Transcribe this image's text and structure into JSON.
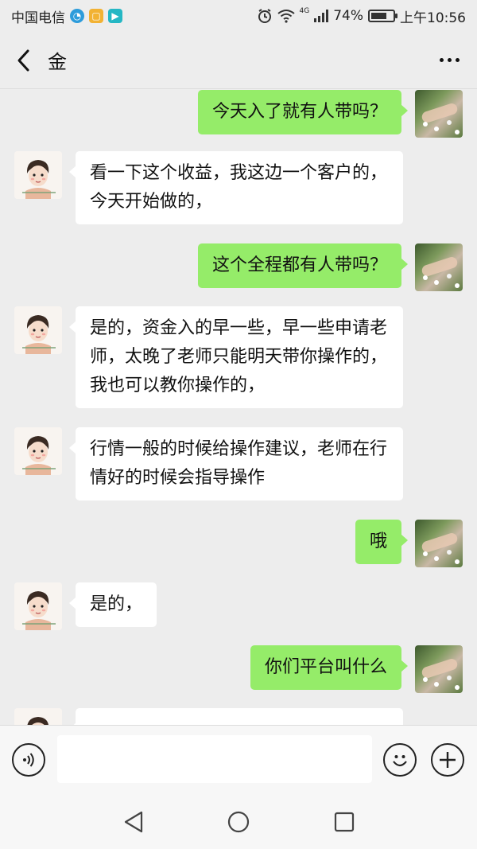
{
  "status": {
    "carrier": "中国电信",
    "network": "4G",
    "battery": "74%",
    "battery_level": 0.74,
    "time": "上午10:56",
    "icons": [
      "alarm-icon",
      "wifi-icon",
      "signal-icon"
    ]
  },
  "header": {
    "title": "金",
    "back_icon": "chevron-left-icon",
    "more_icon": "more-dots-icon"
  },
  "messages": [
    {
      "side": "right",
      "text": "今天入了就有人带吗？"
    },
    {
      "side": "left",
      "text": "看一下这个收益，我这边一个客户的，今天开始做的，"
    },
    {
      "side": "right",
      "text": "这个全程都有人带吗？"
    },
    {
      "side": "left",
      "text": "是的，资金入的早一些，早一些申请老师，太晚了老师只能明天带你操作的，我也可以教你操作的，"
    },
    {
      "side": "left",
      "text": "行情一般的时候给操作建议，老师在行情好的时候会指导操作"
    },
    {
      "side": "right",
      "text": "哦"
    },
    {
      "side": "left",
      "text": "是的，"
    },
    {
      "side": "right",
      "text": "你们平台叫什么"
    }
  ],
  "input": {
    "placeholder": "",
    "value": ""
  },
  "colors": {
    "background": "#ededed",
    "sent_bubble": "#95ec69",
    "received_bubble": "#ffffff"
  }
}
